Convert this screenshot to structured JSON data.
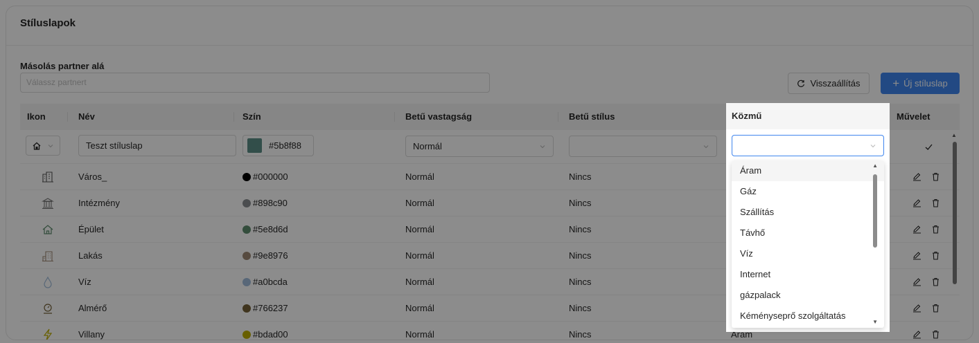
{
  "page": {
    "title": "Stíluslapok",
    "copy_label": "Másolás partner alá",
    "partner_placeholder": "Válassz partnert",
    "reset_label": "Visszaállítás",
    "new_label": "Új stíluslap"
  },
  "table": {
    "headers": {
      "icon": "Ikon",
      "name": "Név",
      "color": "Szín",
      "weight": "Betű vastagság",
      "style": "Betű stílus",
      "utility": "Közmű",
      "action": "Művelet"
    },
    "edit_row": {
      "icon": "home-icon",
      "name": "Teszt stíluslap",
      "color": "#5b8f88",
      "weight": "Normál",
      "style": "",
      "utility": ""
    },
    "rows": [
      {
        "icon": "city-icon",
        "name": "Város_",
        "color": "#000000",
        "weight": "Normál",
        "style": "Nincs"
      },
      {
        "icon": "institution-icon",
        "name": "Intézmény",
        "color": "#898c90",
        "weight": "Normál",
        "style": "Nincs"
      },
      {
        "icon": "house-icon",
        "name": "Épület",
        "color": "#5e8d6d",
        "weight": "Normál",
        "style": "Nincs"
      },
      {
        "icon": "apartment-icon",
        "name": "Lakás",
        "color": "#9e8976",
        "weight": "Normál",
        "style": "Nincs"
      },
      {
        "icon": "water-drop-icon",
        "name": "Víz",
        "color": "#a0bcda",
        "weight": "Normál",
        "style": "Nincs"
      },
      {
        "icon": "meter-icon",
        "name": "Almérő",
        "color": "#766237",
        "weight": "Normál",
        "style": "Nincs"
      },
      {
        "icon": "lightning-icon",
        "name": "Villany",
        "color": "#bdad00",
        "weight": "Normál",
        "style": "Nincs",
        "utility": "Áram"
      }
    ]
  },
  "utility_dropdown": {
    "options": [
      "Áram",
      "Gáz",
      "Szállítás",
      "Távhő",
      "Víz",
      "Internet",
      "gázpalack",
      "Kéményseprő szolgáltatás"
    ]
  },
  "colors": {
    "primary": "#3f85ee",
    "overlay": "rgba(0,0,0,0.45)"
  }
}
